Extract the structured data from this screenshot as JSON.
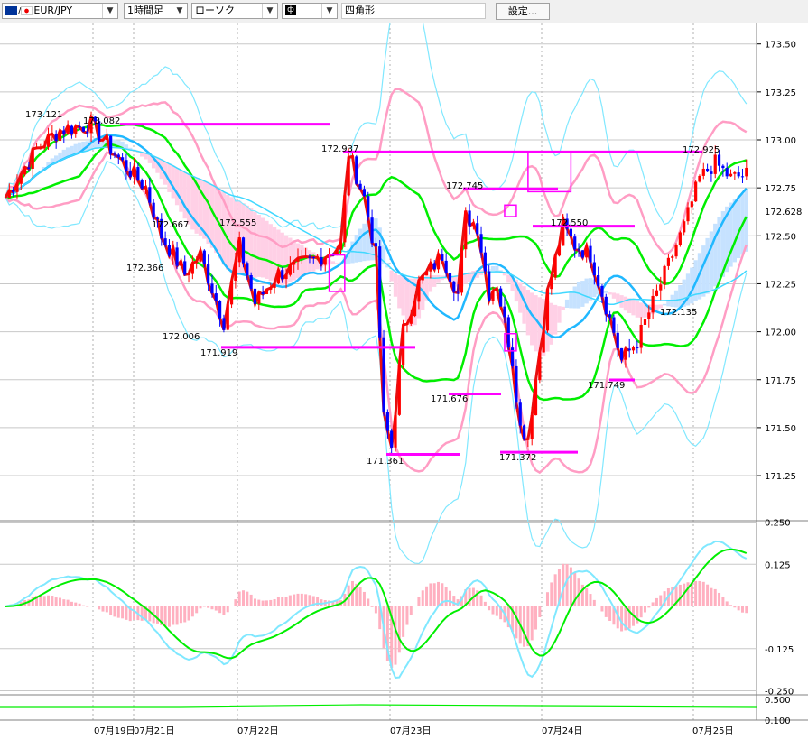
{
  "toolbar": {
    "symbol": "EUR/JPY",
    "timeframe": "1時間足",
    "chart_style": "ローソク",
    "color_glyph": "ф",
    "drawing_tool": "四角形",
    "settings_label": "設定..."
  },
  "chart_data": [
    {
      "type": "candlestick",
      "title": "",
      "x_tick_labels": [
        "07月19日",
        "07月21日",
        "07月22日",
        "07月23日",
        "07月24日",
        "07月25日"
      ],
      "y_tick_labels": [
        "173.50",
        "173.25",
        "173.00",
        "172.75",
        "172.50",
        "172.25",
        "172.00",
        "171.75",
        "171.50",
        "171.25"
      ],
      "ylim": [
        171.125,
        173.6
      ],
      "current_price_label": "172.628",
      "price_annotations": [
        "173.121",
        "173.082",
        "172.667",
        "172.366",
        "172.555",
        "172.006",
        "171.919",
        "172.937",
        "172.745",
        "171.676",
        "171.361",
        "171.372",
        "172.550",
        "171.749",
        "172.135",
        "172.925"
      ],
      "horizontal_levels": [
        173.082,
        172.937,
        172.745,
        172.55,
        171.919,
        171.749,
        171.676,
        171.372,
        171.361
      ],
      "rectangles": [
        {
          "x_from_candle": 83,
          "x_to_candle": 87,
          "y_from": 172.4,
          "y_to": 172.21
        },
        {
          "x_from_candle": 128,
          "x_to_candle": 131,
          "y_from": 172.66,
          "y_to": 172.6
        },
        {
          "x_from_candle": 128,
          "x_to_candle": 131,
          "y_from": 171.99,
          "y_to": 171.9
        },
        {
          "x_from_candle": 134,
          "x_to_candle": 145,
          "y_from": 172.94,
          "y_to": 172.73
        }
      ],
      "colors": {
        "up": "#ff0000",
        "down": "#0000ff",
        "level": "#ff00ff",
        "bb_inner": "#ff9dc4",
        "bb_outer": "#80e8ff",
        "ma_green": "#00ee00",
        "ma_blue": "#20b8ff",
        "ma_cyan": "#40d8ff",
        "lagging": "#e81010",
        "cloud_up": "#c6e2ff",
        "cloud_down": "#ffd0e6"
      }
    },
    {
      "type": "macd",
      "y_tick_labels": [
        "0.250",
        "0.125",
        "-0.125",
        "-0.250"
      ],
      "ylim": [
        -0.27,
        0.27
      ]
    },
    {
      "type": "line",
      "y_tick_labels": [
        "0.500",
        "0.100"
      ]
    }
  ]
}
